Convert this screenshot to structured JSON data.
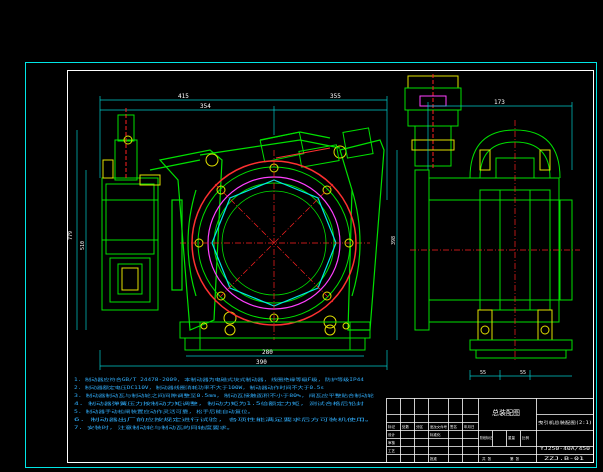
{
  "drawing": {
    "colors": {
      "background": "#000000",
      "frame": "#00e6e6",
      "title_block": "#ffffff",
      "body_outline": "#00e000",
      "center_line": "#ff2020",
      "red_part": "#ff3030",
      "magenta_part": "#ff40ff",
      "dimension": "#00cccc",
      "yellow_part": "#e0e000",
      "note_text": "#30b0ff"
    },
    "dimensions": {
      "overall_width": "415",
      "left_width": "354",
      "right_width": "355",
      "base_width": "390",
      "inner_base": "280",
      "right_view_width": "173",
      "right_view_left": "55",
      "right_view_right": "55",
      "height_total": "779",
      "height_left": "510",
      "height_right": "398"
    },
    "notes": [
      "1. 制动器应符合GB/T 24478-2009, 本制动器为电磁式块式制动器, 线圈绝缘等级F级, 防护等级IP44",
      "2. 制动器额定电压DC110V, 制动器线圈消耗功率不大于100W, 制动器动作时间不大于0.5s",
      "3. 制动器制动瓦与制动轮之间间隙调整至0.5mm, 制动瓦接触面积不小于80%, 闸瓦应平整贴合制动轮",
      "4. 制动器弹簧压力按制动力矩调整, 制动力矩为1.5倍额定力矩, 测试合格后铅封",
      "5. 制动器手动松闸装置应动作灵活可靠, 松手后能自动复位。",
      "6. 制动器出厂前应按规定进行试验, 各项性能满足要求后方可装机使用。",
      "7. 安装时, 注意制动轮与制动瓦的同轴度要求。"
    ],
    "title_block": {
      "drawing_name": "总装配图",
      "company": "曳引机总装配图(2:1)",
      "drawing_code": "YJ250-40A/450",
      "sheet": "ZZJ.B-01",
      "label_grid": [
        "标记",
        "处数",
        "分区",
        "更改文件号",
        "签名",
        "年月日"
      ],
      "label_grid2": [
        "设计",
        "标准化",
        "阶段标记",
        "重量",
        "比例"
      ],
      "label_grid3": [
        "审核",
        "工艺",
        "批准"
      ],
      "label_grid4": [
        "共 张",
        "第 张"
      ]
    }
  }
}
